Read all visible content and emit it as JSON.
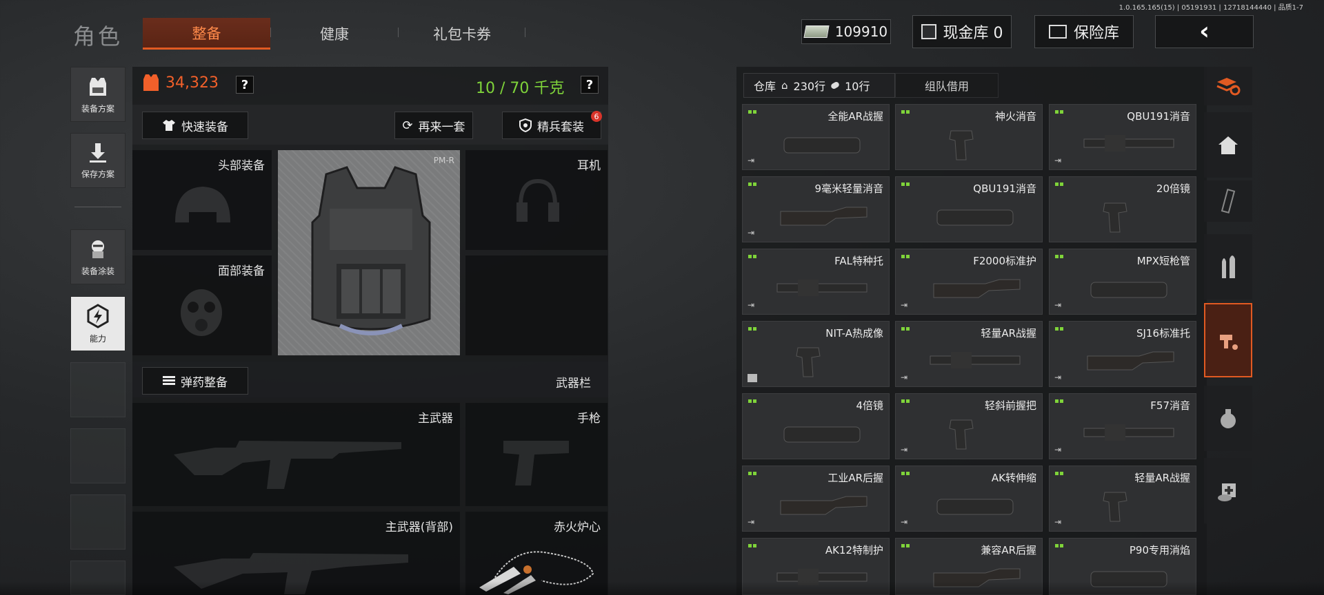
{
  "version": "1.0.165.165(15) | 05191931 | 12718144440 | 品质1-7",
  "page_title": "角色",
  "tabs": [
    {
      "label": "整备",
      "active": true
    },
    {
      "label": "健康",
      "active": false
    },
    {
      "label": "礼包卡券",
      "active": false
    }
  ],
  "header": {
    "currency": "109910",
    "cash_vault": "现金库 0",
    "safe": "保险库"
  },
  "left_nav": [
    {
      "label": "装备方案",
      "icon": "vest-plan-icon"
    },
    {
      "label": "保存方案",
      "icon": "download-icon"
    },
    {
      "label": "装备涂装",
      "icon": "paint-icon"
    },
    {
      "label": "能力",
      "icon": "ability-icon"
    }
  ],
  "loadout": {
    "armor_value": "34,323",
    "weight": "10 / 70 千克",
    "quick_equip": "快速装备",
    "redo_set": "再来一套",
    "elite_set": "精兵套装",
    "elite_badge": "6",
    "slots": {
      "head": "头部装备",
      "face": "面部装备",
      "ear": "耳机",
      "vest_label": "PM-R"
    },
    "ammo_button": "弹药整备",
    "weapon_bar": "武器栏",
    "primary": "主武器",
    "pistol": "手枪",
    "primary_back": "主武器(背部)",
    "charm": "赤火炉心"
  },
  "warehouse": {
    "title": "仓库",
    "rows": "230行",
    "cols": "10行",
    "team_borrow": "组队借用",
    "items": [
      {
        "name": "全能AR战握",
        "tag": "return"
      },
      {
        "name": "神火消音",
        "tag": ""
      },
      {
        "name": "QBU191消音",
        "tag": "return"
      },
      {
        "name": "9毫米轻量消音",
        "tag": "return"
      },
      {
        "name": "QBU191消音",
        "tag": ""
      },
      {
        "name": "20倍镜",
        "tag": ""
      },
      {
        "name": "FAL特种托",
        "tag": "return"
      },
      {
        "name": "F2000标准护",
        "tag": "return"
      },
      {
        "name": "MPX短枪管",
        "tag": "return"
      },
      {
        "name": "NIT-A热成像",
        "tag": "box"
      },
      {
        "name": "轻量AR战握",
        "tag": "return"
      },
      {
        "name": "SJ16标准托",
        "tag": "return"
      },
      {
        "name": "4倍镜",
        "tag": ""
      },
      {
        "name": "轻斜前握把",
        "tag": "return"
      },
      {
        "name": "F57消音",
        "tag": "return"
      },
      {
        "name": "工业AR后握",
        "tag": "return"
      },
      {
        "name": "AK转伸缩",
        "tag": "return"
      },
      {
        "name": "轻量AR战握",
        "tag": "return"
      },
      {
        "name": "AK12特制护",
        "tag": ""
      },
      {
        "name": "兼容AR后握",
        "tag": ""
      },
      {
        "name": "P90专用消焰",
        "tag": ""
      }
    ]
  },
  "colors": {
    "accent": "#e25a22",
    "armor": "#f2602a",
    "weight": "#7fd43a"
  }
}
